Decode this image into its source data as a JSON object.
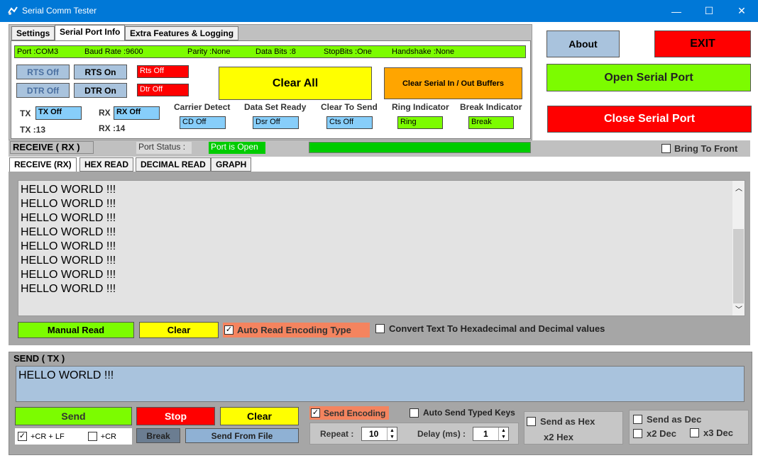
{
  "window": {
    "title": "Serial Comm Tester",
    "minimize": "—",
    "maximize": "☐",
    "close": "✕"
  },
  "tabs": [
    "Settings",
    "Serial Port Info",
    "Extra Features & Logging"
  ],
  "info": {
    "port": "Port :COM3",
    "baud": "Baud Rate :9600",
    "parity": "Parity :None",
    "databits": "Data Bits :8",
    "stopbits": "StopBits :One",
    "handshake": "Handshake :None"
  },
  "signals": {
    "rts_off": "RTS  Off",
    "rts_on": "RTS  On",
    "rts_state": "Rts Off",
    "dtr_off": "DTR Off",
    "dtr_on": "DTR  On",
    "dtr_state": "Dtr Off"
  },
  "clear_all": "Clear All",
  "clear_buffers": "Clear Serial In / Out Buffers",
  "tx": {
    "label": "TX",
    "value": "TX Off",
    "count": "TX :13"
  },
  "rx": {
    "label": "RX",
    "value": "RX Off",
    "count": "RX :14"
  },
  "lines": {
    "cd": {
      "label": "Carrier Detect",
      "value": "CD Off"
    },
    "dsr": {
      "label": "Data Set Ready",
      "value": "Dsr Off"
    },
    "cts": {
      "label": "Clear To Send",
      "value": "Cts Off"
    },
    "ring": {
      "label": "Ring Indicator",
      "value": "Ring"
    },
    "brk": {
      "label": "Break Indicator",
      "value": "Break"
    }
  },
  "right_buttons": {
    "about": "About",
    "exit": "EXIT",
    "open": "Open Serial Port",
    "close": "Close Serial Port"
  },
  "status": {
    "receive_header": "RECEIVE  ( RX )",
    "port_status_label": "Port Status :",
    "port_status_value": "Port is Open",
    "bring_to_front": "Bring To Front"
  },
  "rx_tabs": [
    "RECEIVE  (RX)",
    "HEX READ",
    "DECIMAL READ",
    "GRAPH"
  ],
  "rx_text": [
    "HELLO WORLD !!!",
    "HELLO WORLD !!!",
    "HELLO WORLD !!!",
    "HELLO WORLD !!!",
    "HELLO WORLD !!!",
    "HELLO WORLD !!!",
    "HELLO WORLD !!!",
    "HELLO WORLD !!!"
  ],
  "rx_controls": {
    "manual_read": "Manual Read",
    "clear": "Clear",
    "auto_read": "Auto Read Encoding Type",
    "auto_read_checked": true,
    "convert": "Convert Text To Hexadecimal and Decimal values",
    "convert_checked": false
  },
  "send": {
    "header": "SEND  ( TX )",
    "text": "HELLO WORLD !!!",
    "send": "Send",
    "stop": "Stop",
    "clear": "Clear",
    "send_encoding": "Send Encoding",
    "auto_send": "Auto Send Typed Keys",
    "crlf": "+CR + LF",
    "cr": "+CR",
    "break": "Break",
    "send_file": "Send From File",
    "repeat_label": "Repeat :",
    "repeat_value": "10",
    "delay_label": "Delay (ms) :",
    "delay_value": "1",
    "send_hex": "Send as Hex",
    "x2_hex": "x2 Hex",
    "send_dec": "Send as Dec",
    "x2_dec": "x2 Dec",
    "x3_dec": "x3 Dec"
  },
  "colors": {
    "titlebar": "#0078d7",
    "green": "#7cfc00",
    "red": "#ff0000",
    "yellow": "#ffff00",
    "orange": "#ffa500",
    "lightblue": "#87cefa"
  }
}
